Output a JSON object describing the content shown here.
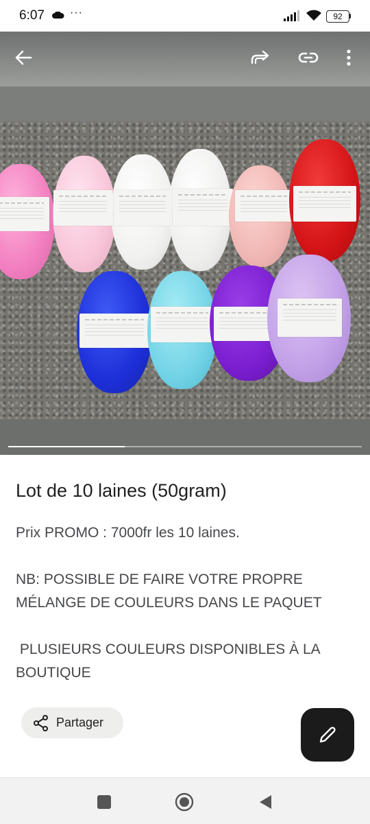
{
  "status_bar": {
    "time": "6:07",
    "more": "···",
    "battery": "92"
  },
  "media": {
    "progress_fraction": 0.33
  },
  "post": {
    "title": "Lot de 10 laines (50gram)",
    "lines": [
      "Prix PROMO : 7000fr les 10 laines.",
      "",
      "NB: POSSIBLE DE FAIRE VOTRE PROPRE",
      "MÉLANGE DE COULEURS DANS LE PAQUET",
      "",
      " PLUSIEURS COULEURS DISPONIBLES À LA",
      "BOUTIQUE"
    ]
  },
  "actions": {
    "share_label": "Partager"
  },
  "icons": {
    "back": "arrow-left-icon",
    "forward": "forward-icon",
    "link": "link-icon",
    "more": "more-vert-icon",
    "share": "share-icon",
    "edit": "pencil-icon"
  },
  "colors": {
    "fab": "#1b1b1b",
    "share_bg": "#eeeeec"
  }
}
